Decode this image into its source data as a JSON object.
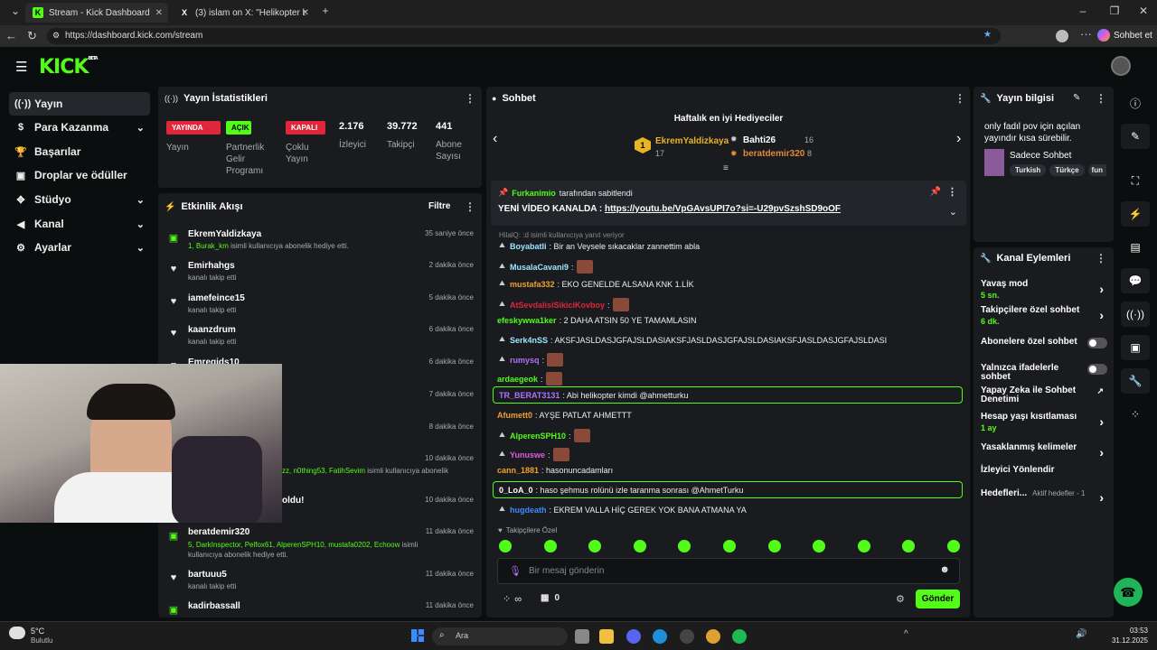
{
  "browser": {
    "tabs": [
      {
        "title": "Stream - Kick Dashboard",
        "active": true
      },
      {
        "title": "(3) islam on X: \"Helikopter bizi tara",
        "active": false
      }
    ],
    "url": "https://dashboard.kick.com/stream",
    "copilot_label": "Sohbet et"
  },
  "kick": {
    "logo": "KICK",
    "logo_badge": "BETA"
  },
  "sidebar": {
    "items": [
      {
        "label": "Yayın",
        "icon": "signal-icon",
        "active": true,
        "has_chevron": false
      },
      {
        "label": "Para Kazanma",
        "icon": "dollar-icon",
        "active": false,
        "has_chevron": true
      },
      {
        "label": "Başarılar",
        "icon": "trophy-icon",
        "active": false,
        "has_chevron": false
      },
      {
        "label": "Droplar ve ödüller",
        "icon": "gift-icon",
        "active": false,
        "has_chevron": false
      },
      {
        "label": "Stüdyo",
        "icon": "gamepad-icon",
        "active": false,
        "has_chevron": true
      },
      {
        "label": "Kanal",
        "icon": "megaphone-icon",
        "active": false,
        "has_chevron": true
      },
      {
        "label": "Ayarlar",
        "icon": "gear-icon",
        "active": false,
        "has_chevron": true
      }
    ]
  },
  "stats": {
    "title": "Yayın İstatistikleri",
    "tags": [
      {
        "tag": "YAYINDA",
        "label": "Yayın",
        "color": "#e0263a"
      },
      {
        "tag": "AÇIK",
        "label": "Partnerlik Gelir Programı",
        "color": "#53fc18"
      },
      {
        "tag": "KAPALI",
        "label": "Çoklu Yayın",
        "color": "#e0263a"
      }
    ],
    "numbers": [
      {
        "value": "2.176",
        "label": "İzleyici"
      },
      {
        "value": "39.772",
        "label": "Takipçi"
      },
      {
        "value": "441",
        "label": "Abone Sayısı"
      }
    ]
  },
  "activity": {
    "title": "Etkinlik Akışı",
    "filter_label": "Filtre",
    "items": [
      {
        "name": "EkremYaldizkaya",
        "desc_highlight": "1, Burak_km",
        "desc": " isimli kullanıcıya abonelik hediye etti.",
        "time": "35 saniye önce",
        "icon": "gift"
      },
      {
        "name": "Emirhahgs",
        "desc_highlight": "",
        "desc": "kanalı takip etti",
        "time": "2 dakika önce",
        "icon": "heart"
      },
      {
        "name": "iamefeince15",
        "desc_highlight": "",
        "desc": "kanalı takip etti",
        "time": "5 dakika önce",
        "icon": "heart"
      },
      {
        "name": "kaanzdrum",
        "desc_highlight": "",
        "desc": "kanalı takip etti",
        "time": "6 dakika önce",
        "icon": "heart"
      },
      {
        "name": "Emregids10",
        "desc_highlight": "",
        "desc": "",
        "time": "6 dakika önce",
        "icon": "heart"
      },
      {
        "name": "",
        "desc_highlight": "",
        "desc": "",
        "time": "7 dakika önce",
        "icon": ""
      },
      {
        "name": "",
        "desc_highlight": "",
        "desc": "",
        "time": "8 dakika önce",
        "icon": ""
      },
      {
        "name": "",
        "desc_highlight": "zz, n0thing53, FatihSevim",
        "desc": " isimli kullanıcıya abonelik",
        "time": "10 dakika önce",
        "icon": ""
      },
      {
        "name": "oldu!",
        "desc_highlight": "",
        "desc": "",
        "time": "10 dakika önce",
        "icon": ""
      },
      {
        "name": "beratdemir320",
        "desc_highlight": "5, DarkInspector, Pelfox61, AlperenSPH10, mustafa0202, Echoow",
        "desc": " isimli kullanıcıya abonelik hediye etti.",
        "time": "11 dakika önce",
        "icon": "gift"
      },
      {
        "name": "bartuuu5",
        "desc_highlight": "",
        "desc": "kanalı takip etti",
        "time": "11 dakika önce",
        "icon": "heart"
      },
      {
        "name": "kadirbassall",
        "desc_highlight": "",
        "desc": "",
        "time": "11 dakika önce",
        "icon": "gift"
      }
    ]
  },
  "chat": {
    "title": "Sohbet",
    "gifters_title": "Haftalık en iyi Hediyeciler",
    "gifters": [
      {
        "rank": "1",
        "name": "EkremYaldizkaya",
        "count": "17"
      },
      {
        "rank": "",
        "name": "Bahti26",
        "count": "16"
      },
      {
        "rank": "",
        "name": "beratdemir320",
        "count": "8"
      }
    ],
    "pinned_by": "Furkanimio",
    "pinned_by_suffix": "tarafından sabitlendi",
    "pinned_text": "YENİ VİDEO KANALDA : ",
    "pinned_link": "https://youtu.be/VpGAvsUPI7o?si=-U29pvSzshSD9oOF",
    "reply_note": "HilalQ: :d isimli kullanıcıya yanıt veriyor",
    "messages": [
      {
        "user": "Boyabatli",
        "color": "#9ee6ff",
        "text": ": Bir an Veysele sıkacaklar zannettim abla",
        "emote": false,
        "highlight": false
      },
      {
        "user": "MusalaCavani9",
        "color": "#9ee6ff",
        "text": ":",
        "emote": true,
        "highlight": false
      },
      {
        "user": "mustafa332",
        "color": "#f0a030",
        "text": ": EKO GENELDE ALSANA KNK 1.LİK",
        "emote": false,
        "highlight": false
      },
      {
        "user": "AtSevdalisiSikiciKovboy",
        "color": "#e0263a",
        "text": ":",
        "emote": true,
        "highlight": false
      },
      {
        "user": "efeskywwa1ker",
        "color": "#53fc18",
        "text": ": 2 DAHA ATSIN 50 YE TAMAMLASIN",
        "emote": false,
        "highlight": false
      },
      {
        "user": "Serk4nSS",
        "color": "#9ee6ff",
        "text": ": AKSFJASLDASJGFAJSLDASIAKSFJASLDASJGFAJSLDASIAKSFJASLDASJGFAJSLDASI",
        "emote": false,
        "highlight": false
      },
      {
        "user": "rumysq",
        "color": "#b070ff",
        "text": ":",
        "emote": true,
        "highlight": false
      },
      {
        "user": "ardaegeok",
        "color": "#53fc18",
        "text": ":",
        "emote": true,
        "highlight": false
      },
      {
        "user": "TR_BERAT3131",
        "color": "#b070ff",
        "text": ": Abi helikopter kimdi @ahmetturku",
        "emote": false,
        "highlight": true
      },
      {
        "user": "Afumett0",
        "color": "#f0a030",
        "text": ": AYŞE PATLAT AHMETTT",
        "emote": false,
        "highlight": false
      },
      {
        "user": "AlperenSPH10",
        "color": "#53fc18",
        "text": ":",
        "emote": true,
        "highlight": false
      },
      {
        "user": "Yunuswe",
        "color": "#e05ae0",
        "text": ":",
        "emote": true,
        "highlight": false
      },
      {
        "user": "cann_1881",
        "color": "#f0a030",
        "text": ": hasonuncadamları",
        "emote": false,
        "highlight": false
      },
      {
        "user": "0_LoA_0",
        "color": "#ffffff",
        "text": ": haso şehmus rolünü izle taranma sonrası @AhmetTurku",
        "emote": false,
        "highlight": true
      },
      {
        "user": "hugdeath",
        "color": "#3a8cff",
        "text": ": EKREM VALLA HİÇ GEREK YOK BANA ATMANA YA",
        "emote": false,
        "highlight": false
      }
    ],
    "followers_only_label": "Takipçilere Özel",
    "input_placeholder": "Bir mesaj gönderin",
    "infinity": "∞",
    "counter": "0",
    "send_label": "Gönder"
  },
  "stream_info": {
    "title": "Yayın bilgisi",
    "description": "only fadıl pov için açılan yayındır kısa sürebilir.",
    "category": "Sadece Sohbet",
    "tags": [
      "Turkish",
      "Türkçe",
      "fun"
    ]
  },
  "channel_actions": {
    "title": "Kanal Eylemleri",
    "items": [
      {
        "label": "Yavaş mod",
        "sub": "5 sn.",
        "control": "chevron"
      },
      {
        "label": "Takipçilere özel sohbet",
        "sub": "6 dk.",
        "control": "chevron"
      },
      {
        "label": "Abonelere özel sohbet",
        "sub": "",
        "control": "toggle"
      },
      {
        "label": "Yalnızca ifadelerle sohbet",
        "sub": "",
        "control": "toggle"
      },
      {
        "label": "Yapay Zeka ile Sohbet Denetimi",
        "sub": "",
        "control": "external"
      },
      {
        "label": "Hesap yaşı kısıtlaması",
        "sub": "1 ay",
        "control": "chevron"
      },
      {
        "label": "Yasaklanmış kelimeler",
        "sub": "",
        "control": "chevron"
      },
      {
        "label": "İzleyici Yönlendir",
        "sub": "",
        "control": ""
      },
      {
        "label": "Hedefleri...",
        "sub": "Aktif hedefler - 1",
        "control": "chevron"
      }
    ]
  },
  "taskbar": {
    "weather_temp": "5°C",
    "weather_desc": "Bulutlu",
    "search_placeholder": "Ara",
    "time": "03:53",
    "date": "31.12.2025"
  },
  "colors": {
    "accent": "#53fc18",
    "live": "#e0263a",
    "panel": "#191b1f",
    "bg": "#0b0e0f"
  }
}
